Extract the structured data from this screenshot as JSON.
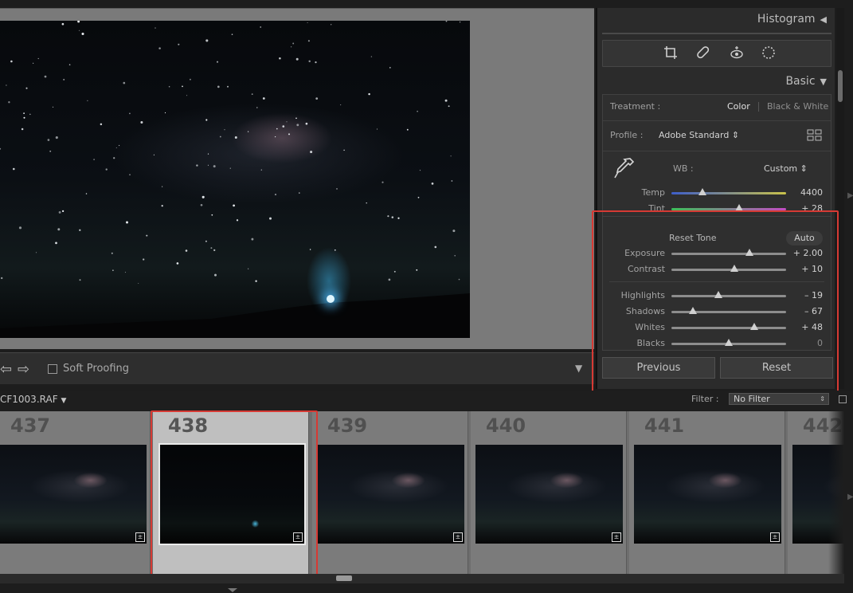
{
  "canvas": {
    "soft_proofing_label": "Soft Proofing",
    "prev_arrow": "⇦",
    "next_arrow": "⇨",
    "toolbar_menu_icon": "chevron-down-icon",
    "toolbar_menu_glyph": "▼"
  },
  "right_panel": {
    "histogram": {
      "title": "Histogram",
      "collapse_glyph": "◀"
    },
    "tools": [
      {
        "name": "crop-icon",
        "glyph": "⌗"
      },
      {
        "name": "healing-icon",
        "glyph": "✎"
      },
      {
        "name": "red-eye-icon",
        "glyph": "◉"
      },
      {
        "name": "mask-icon",
        "glyph": "◌"
      }
    ],
    "basic": {
      "title": "Basic",
      "expand_glyph": "▼",
      "treatment_label": "Treatment :",
      "treatment_options": [
        "Color",
        "Black & White"
      ],
      "treatment_selected": "Color",
      "profile_label": "Profile :",
      "profile_value": "Adobe Standard ⇕",
      "wb_label": "WB :",
      "wb_value": "Custom ⇕",
      "reset_tone_label": "Reset Tone",
      "auto_label": "Auto",
      "sliders": [
        {
          "label": "Temp",
          "value": "4400",
          "level": 0.27,
          "track": "temp"
        },
        {
          "label": "Tint",
          "value": "+ 28",
          "level": 0.59,
          "track": "tint"
        },
        {
          "label": "Exposure",
          "value": "+ 2.00",
          "level": 0.68,
          "track": "gray"
        },
        {
          "label": "Contrast",
          "value": "+ 10",
          "level": 0.55,
          "track": "gray"
        },
        {
          "label": "Highlights",
          "value": "– 19",
          "level": 0.41,
          "track": "gray"
        },
        {
          "label": "Shadows",
          "value": "– 67",
          "level": 0.19,
          "track": "gray"
        },
        {
          "label": "Whites",
          "value": "+ 48",
          "level": 0.72,
          "track": "gray"
        },
        {
          "label": "Blacks",
          "value": "0",
          "level": 0.5,
          "track": "gray"
        }
      ]
    },
    "previous_button": "Previous",
    "reset_button": "Reset"
  },
  "filmstrip_bar": {
    "filename": "CF1003.RAF",
    "filename_menu_glyph": "▼",
    "filter_label": "Filter :",
    "filter_value": "No Filter"
  },
  "filmstrip": {
    "cells": [
      {
        "index": "437",
        "thumb": "milky-way"
      },
      {
        "index": "438",
        "thumb": "dark",
        "selected": true
      },
      {
        "index": "439",
        "thumb": "milky-way"
      },
      {
        "index": "440",
        "thumb": "milky-way"
      },
      {
        "index": "441",
        "thumb": "milky-way"
      },
      {
        "index": "442",
        "thumb": "milky-way"
      }
    ]
  },
  "colors": {
    "highlight_outline": "#d63a34",
    "temp_track": [
      "#3e5ec9",
      "#c9c24a"
    ],
    "tint_track": [
      "#3fbf58",
      "#c44bc3"
    ]
  }
}
